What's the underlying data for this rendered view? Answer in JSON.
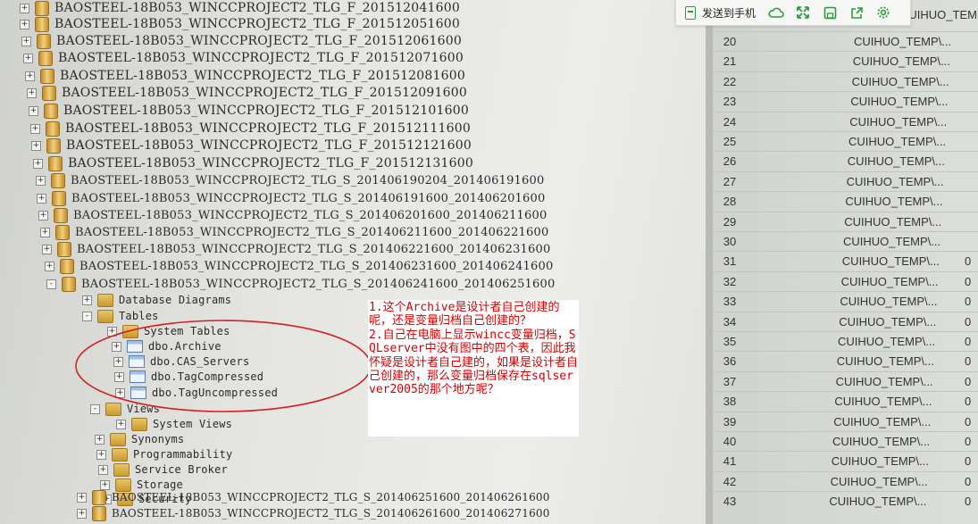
{
  "tree": {
    "rows": [
      {
        "label": "BAOSTEEL-18B053_WINCCPROJECT2_TLG_F_201512041600",
        "type": "db",
        "expander": "+"
      },
      {
        "label": "BAOSTEEL-18B053_WINCCPROJECT2_TLG_F_201512051600",
        "type": "db",
        "expander": "+"
      },
      {
        "label": "BAOSTEEL-18B053_WINCCPROJECT2_TLG_F_201512061600",
        "type": "db",
        "expander": "+"
      },
      {
        "label": "BAOSTEEL-18B053_WINCCPROJECT2_TLG_F_201512071600",
        "type": "db",
        "expander": "+"
      },
      {
        "label": "BAOSTEEL-18B053_WINCCPROJECT2_TLG_F_201512081600",
        "type": "db",
        "expander": "+"
      },
      {
        "label": "BAOSTEEL-18B053_WINCCPROJECT2_TLG_F_201512091600",
        "type": "db",
        "expander": "+"
      },
      {
        "label": "BAOSTEEL-18B053_WINCCPROJECT2_TLG_F_201512101600",
        "type": "db",
        "expander": "+"
      },
      {
        "label": "BAOSTEEL-18B053_WINCCPROJECT2_TLG_F_201512111600",
        "type": "db",
        "expander": "+"
      },
      {
        "label": "BAOSTEEL-18B053_WINCCPROJECT2_TLG_F_201512121600",
        "type": "db",
        "expander": "+"
      },
      {
        "label": "BAOSTEEL-18B053_WINCCPROJECT2_TLG_F_201512131600",
        "type": "db",
        "expander": "+"
      },
      {
        "label": "BAOSTEEL-18B053_WINCCPROJECT2_TLG_S_201406190204_201406191600",
        "type": "db",
        "expander": "+"
      },
      {
        "label": "BAOSTEEL-18B053_WINCCPROJECT2_TLG_S_201406191600_201406201600",
        "type": "db",
        "expander": "+"
      },
      {
        "label": "BAOSTEEL-18B053_WINCCPROJECT2_TLG_S_201406201600_201406211600",
        "type": "db",
        "expander": "+"
      },
      {
        "label": "BAOSTEEL-18B053_WINCCPROJECT2_TLG_S_201406211600_201406221600",
        "type": "db",
        "expander": "+"
      },
      {
        "label": "BAOSTEEL-18B053_WINCCPROJECT2_TLG_S_201406221600_201406231600",
        "type": "db",
        "expander": "+"
      },
      {
        "label": "BAOSTEEL-18B053_WINCCPROJECT2_TLG_S_201406231600_201406241600",
        "type": "db",
        "expander": "+"
      },
      {
        "label": "BAOSTEEL-18B053_WINCCPROJECT2_TLG_S_201406241600_201406251600",
        "type": "db",
        "expander": "-"
      },
      {
        "label": "Database Diagrams",
        "type": "folder",
        "expander": "+"
      },
      {
        "label": "Tables",
        "type": "folder",
        "expander": "-"
      },
      {
        "label": "System Tables",
        "type": "folder",
        "expander": "+"
      },
      {
        "label": "dbo.Archive",
        "type": "table",
        "expander": "+"
      },
      {
        "label": "dbo.CAS_Servers",
        "type": "table",
        "expander": "+"
      },
      {
        "label": "dbo.TagCompressed",
        "type": "table",
        "expander": "+"
      },
      {
        "label": "dbo.TagUncompressed",
        "type": "table",
        "expander": "+"
      },
      {
        "label": "Views",
        "type": "folder",
        "expander": "-"
      },
      {
        "label": "System Views",
        "type": "folder",
        "expander": "+"
      },
      {
        "label": "Synonyms",
        "type": "folder",
        "expander": "+"
      },
      {
        "label": "Programmability",
        "type": "folder",
        "expander": "+"
      },
      {
        "label": "Service Broker",
        "type": "folder",
        "expander": "+"
      },
      {
        "label": "Storage",
        "type": "folder",
        "expander": "+"
      },
      {
        "label": "Security",
        "type": "folder",
        "expander": "+"
      },
      {
        "label": "BAOSTEEL-18B053_WINCCPROJECT2_TLG_S_201406251600_201406261600",
        "type": "db",
        "expander": "+"
      },
      {
        "label": "BAOSTEEL-18B053_WINCCPROJECT2_TLG_S_201406261600_201406271600",
        "type": "db",
        "expander": "+"
      }
    ]
  },
  "grid": {
    "top_text": "CUIHUO_TEMP\\...",
    "rows": [
      {
        "num": "20",
        "text": "CUIHUO_TEMP\\...",
        "value": ""
      },
      {
        "num": "21",
        "text": "CUIHUO_TEMP\\...",
        "value": ""
      },
      {
        "num": "22",
        "text": "CUIHUO_TEMP\\...",
        "value": ""
      },
      {
        "num": "23",
        "text": "CUIHUO_TEMP\\...",
        "value": ""
      },
      {
        "num": "24",
        "text": "CUIHUO_TEMP\\...",
        "value": ""
      },
      {
        "num": "25",
        "text": "CUIHUO_TEMP\\...",
        "value": ""
      },
      {
        "num": "26",
        "text": "CUIHUO_TEMP\\...",
        "value": ""
      },
      {
        "num": "27",
        "text": "CUIHUO_TEMP\\...",
        "value": ""
      },
      {
        "num": "28",
        "text": "CUIHUO_TEMP\\...",
        "value": ""
      },
      {
        "num": "29",
        "text": "CUIHUO_TEMP\\...",
        "value": ""
      },
      {
        "num": "30",
        "text": "CUIHUO_TEMP\\...",
        "value": ""
      },
      {
        "num": "31",
        "text": "CUIHUO_TEMP\\...",
        "value": "0"
      },
      {
        "num": "32",
        "text": "CUIHUO_TEMP\\...",
        "value": "0"
      },
      {
        "num": "33",
        "text": "CUIHUO_TEMP\\...",
        "value": "0"
      },
      {
        "num": "34",
        "text": "CUIHUO_TEMP\\...",
        "value": "0"
      },
      {
        "num": "35",
        "text": "CUIHUO_TEMP\\...",
        "value": "0"
      },
      {
        "num": "36",
        "text": "CUIHUO_TEMP\\...",
        "value": "0"
      },
      {
        "num": "37",
        "text": "CUIHUO_TEMP\\...",
        "value": "0"
      },
      {
        "num": "38",
        "text": "CUIHUO_TEMP\\...",
        "value": "0"
      },
      {
        "num": "39",
        "text": "CUIHUO_TEMP\\...",
        "value": "0"
      },
      {
        "num": "40",
        "text": "CUIHUO_TEMP\\...",
        "value": "0"
      },
      {
        "num": "41",
        "text": "CUIHUO_TEMP\\...",
        "value": "0"
      },
      {
        "num": "42",
        "text": "CUIHUO_TEMP\\...",
        "value": "0"
      },
      {
        "num": "43",
        "text": "CUIHUO_TEMP\\...",
        "value": "0"
      }
    ]
  },
  "toolbar": {
    "send_label": "发送到手机",
    "icons": [
      "phone-send-icon",
      "cloud-icon",
      "expand-icon",
      "save-icon",
      "share-icon",
      "settings-icon"
    ]
  },
  "note": {
    "text": "1.这个Archive是设计者自己创建的呢，还是变量归档自己创建的？\n2.自己在电脑上显示wincc变量归档，SQLserver中没有图中的四个表，因此我怀疑是设计者自己建的，如果是设计者自己创建的，那么变量归档保存在sqlserver2005的那个地方呢？"
  },
  "colors": {
    "note_text": "#d40000",
    "annotation_ellipse": "#d42020",
    "toolbar_icon": "#2a9d3a"
  }
}
